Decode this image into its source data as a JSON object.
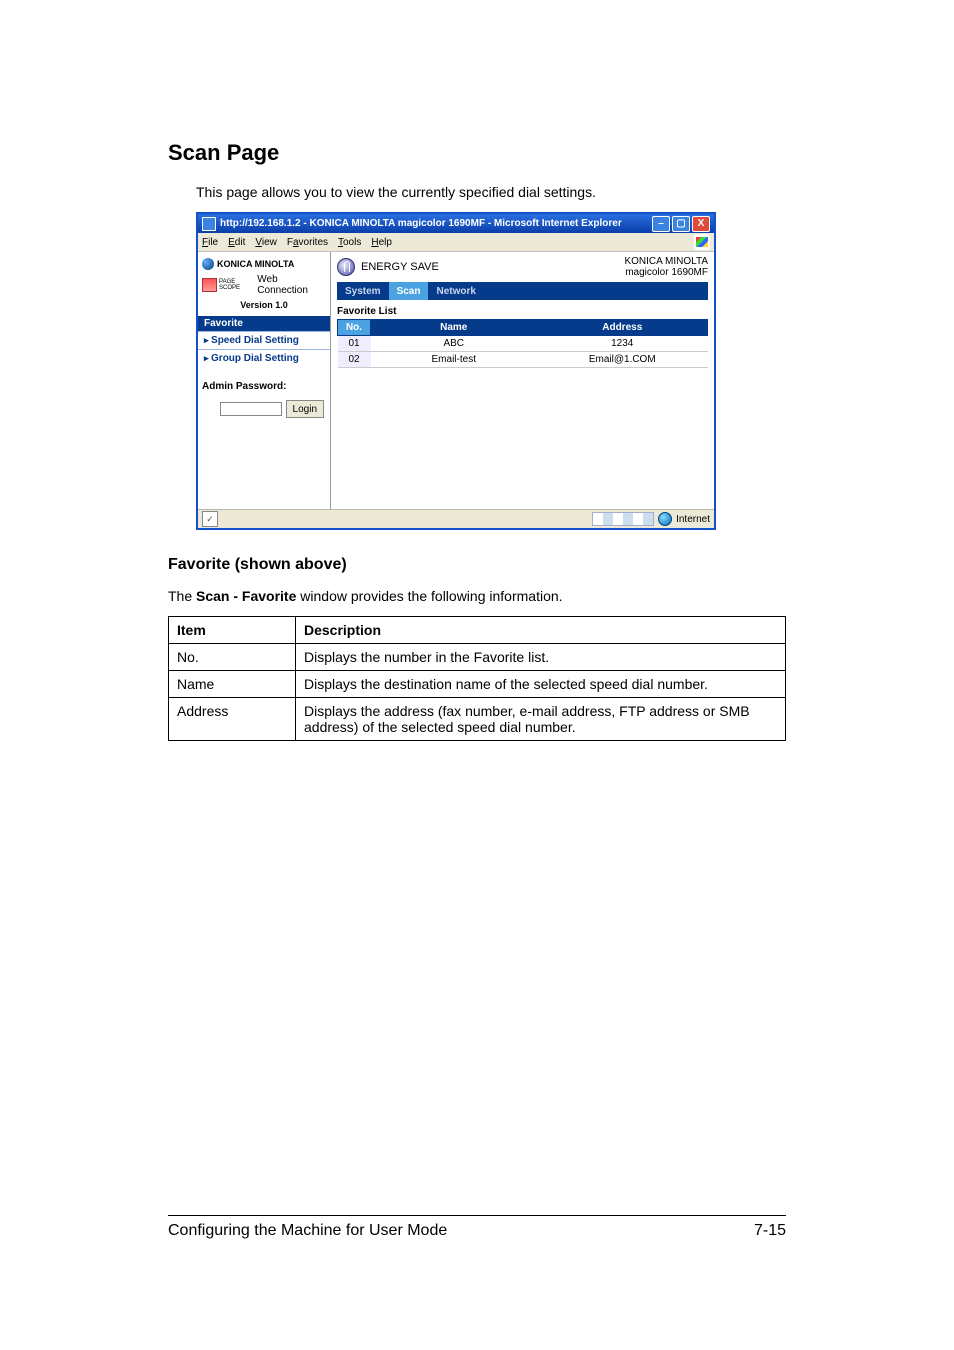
{
  "heading": "Scan Page",
  "intro": "This page allows you to view the currently specified dial settings.",
  "screenshot": {
    "titlebar": "http://192.168.1.2 - KONICA MINOLTA magicolor 1690MF - Microsoft Internet Explorer",
    "winbtns": {
      "min": "–",
      "max": "▢",
      "close": "X"
    },
    "menubar": {
      "file": "File",
      "edit": "Edit",
      "view": "View",
      "favorites": "Favorites",
      "tools": "Tools",
      "help": "Help"
    },
    "sidebar": {
      "brand": "KONICA MINOLTA",
      "webc_prefix": "PAGE SCOPE",
      "webc": "Web Connection",
      "version": "Version 1.0",
      "nav_header": "Favorite",
      "nav_items": [
        "Speed Dial Setting",
        "Group Dial Setting"
      ],
      "admin_pw_label": "Admin Password:",
      "login": "Login"
    },
    "main": {
      "energy_save": "ENERGY SAVE",
      "device_line1": "KONICA MINOLTA",
      "device_line2": "magicolor 1690MF",
      "tabs": [
        "System",
        "Scan",
        "Network"
      ],
      "active_tab": 1,
      "fav_label": "Favorite List",
      "columns": [
        "No.",
        "Name",
        "Address"
      ],
      "rows": [
        {
          "no": "01",
          "name": "ABC",
          "addr": "1234"
        },
        {
          "no": "02",
          "name": "Email-test",
          "addr": "Email@1.COM"
        }
      ]
    },
    "statusbar": {
      "done_icon": "✓",
      "zone": "Internet"
    }
  },
  "subheading": "Favorite (shown above)",
  "subdesc_prefix": "The ",
  "subdesc_bold": "Scan - Favorite",
  "subdesc_suffix": " window provides the following information.",
  "table": {
    "headers": [
      "Item",
      "Description"
    ],
    "rows": [
      {
        "item": "No.",
        "desc": "Displays the number in the Favorite list."
      },
      {
        "item": "Name",
        "desc": "Displays the destination name of the selected speed dial number."
      },
      {
        "item": "Address",
        "desc": "Displays the address (fax number, e-mail address, FTP address or SMB address) of the selected speed dial number."
      }
    ]
  },
  "footer": {
    "left": "Configuring the Machine for User Mode",
    "right": "7-15"
  }
}
